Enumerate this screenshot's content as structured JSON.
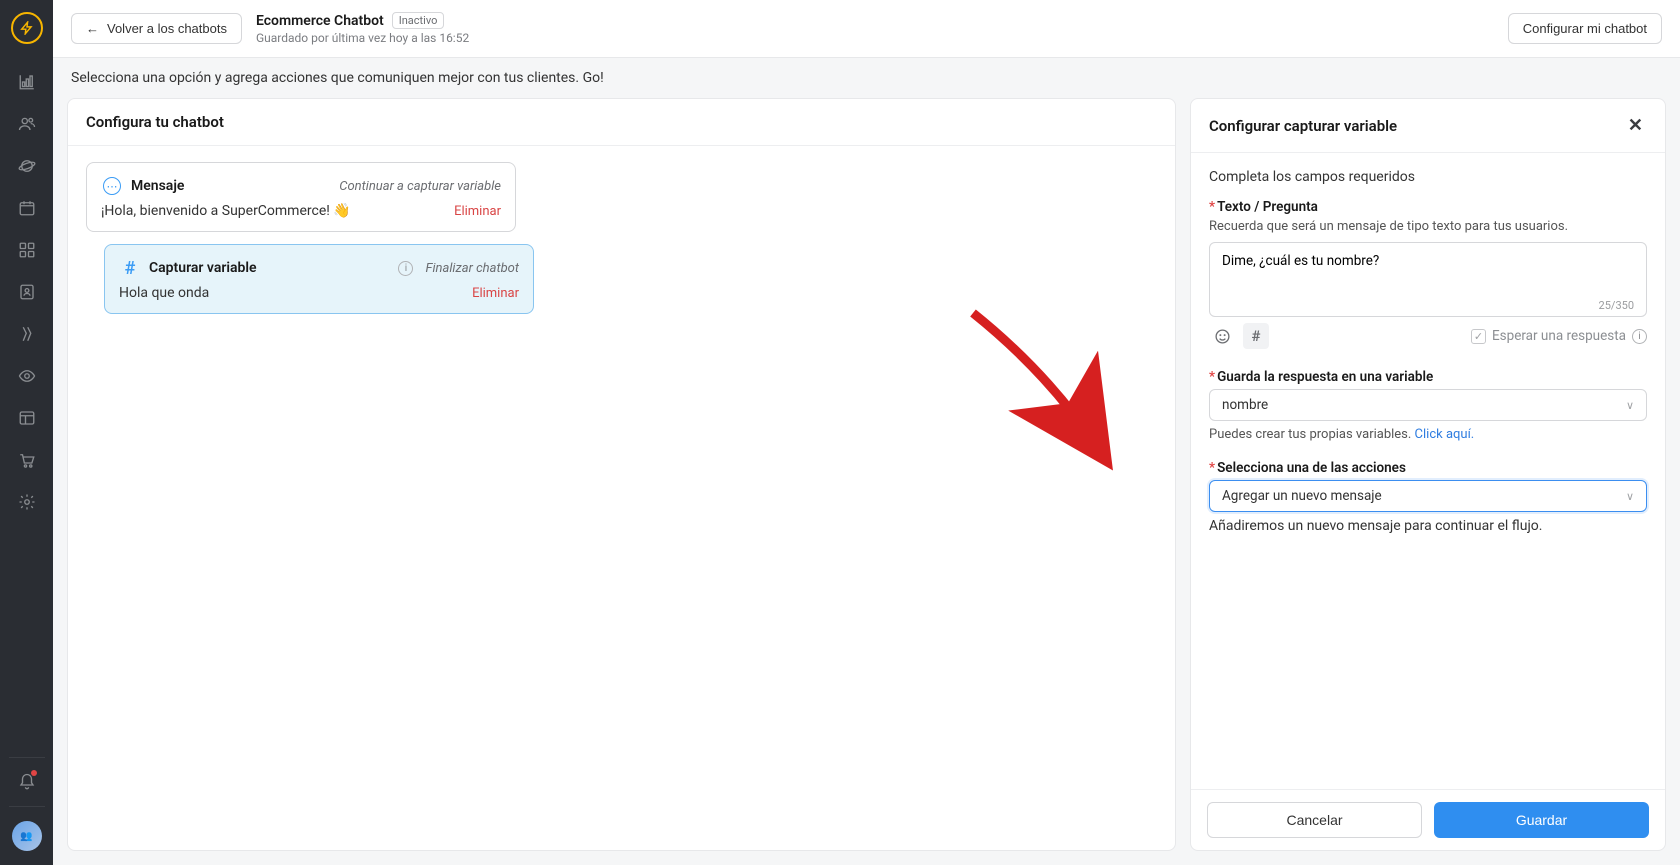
{
  "sidebar": {
    "icons": [
      "chart-icon",
      "users-icon",
      "planet-icon",
      "calendar-icon",
      "apps-icon",
      "contact-icon",
      "tag-icon",
      "eye-icon",
      "layout-icon",
      "cart-icon",
      "settings-icon"
    ]
  },
  "topbar": {
    "back_label": "Volver a los chatbots",
    "title": "Ecommerce Chatbot",
    "status_badge": "Inactivo",
    "saved_text": "Guardado por última vez hoy a las 16:52",
    "config_button": "Configurar mi chatbot"
  },
  "instruction": "Selecciona una opción y agrega acciones que comuniquen mejor con tus clientes. Go!",
  "left_panel": {
    "title": "Configura tu chatbot",
    "card1": {
      "title": "Mensaje",
      "continue": "Continuar a capturar variable",
      "text": "¡Hola, bienvenido a SuperCommerce! 👋",
      "delete": "Eliminar"
    },
    "card2": {
      "title": "Capturar variable",
      "continue": "Finalizar chatbot",
      "text": "Hola que onda",
      "delete": "Eliminar"
    }
  },
  "right_panel": {
    "title": "Configurar capturar variable",
    "note": "Completa los campos requeridos",
    "field1": {
      "label": "Texto / Pregunta",
      "helper": "Recuerda que será un mensaje de tipo texto para tus usuarios.",
      "value": "Dime, ¿cuál es tu nombre?",
      "counter": "25/350"
    },
    "wait_label": "Esperar una respuesta",
    "field2": {
      "label": "Guarda la respuesta en una variable",
      "value": "nombre",
      "helper_prefix": "Puedes crear tus propias variables. ",
      "helper_link": "Click aquí."
    },
    "field3": {
      "label": "Selecciona una de las acciones",
      "value": "Agregar un nuevo mensaje",
      "desc": "Añadiremos un nuevo mensaje para continuar el flujo."
    },
    "cancel": "Cancelar",
    "save": "Guardar"
  }
}
